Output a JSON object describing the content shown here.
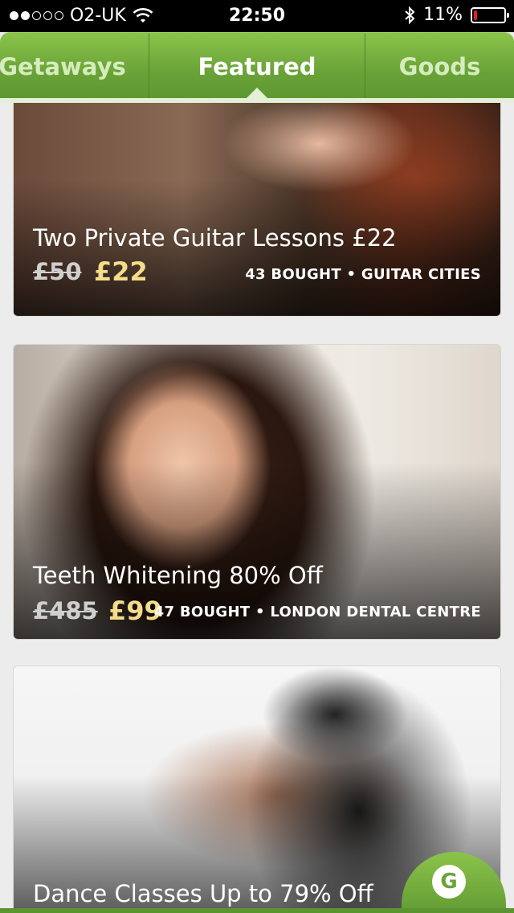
{
  "status_bar": {
    "carrier": "O2-UK",
    "time": "22:50",
    "battery": "11%",
    "battery_level": 0.11,
    "signal_bars_on": 2,
    "signal_bars_total": 5,
    "icons": [
      "wifi-icon",
      "bluetooth-icon",
      "battery-icon"
    ]
  },
  "tabs": [
    {
      "label": "Getaways",
      "active": false
    },
    {
      "label": "Featured",
      "active": true
    },
    {
      "label": "Goods",
      "active": false
    }
  ],
  "deals": [
    {
      "title": "Two Private Guitar Lessons £22",
      "old_price": "£50",
      "new_price": "£22",
      "meta": "43 BOUGHT • GUITAR CITIES"
    },
    {
      "title": "Teeth Whitening 80% Off",
      "old_price": "£485",
      "new_price": "£99",
      "meta": "47 BOUGHT • LONDON DENTAL CENTRE"
    },
    {
      "title": "Dance Classes Up to 79% Off"
    }
  ],
  "floating_button": {
    "label": "G"
  },
  "colors": {
    "brand_green": "#6aa438",
    "price_highlight": "#f4dc8a",
    "battery_low": "#e02020"
  }
}
